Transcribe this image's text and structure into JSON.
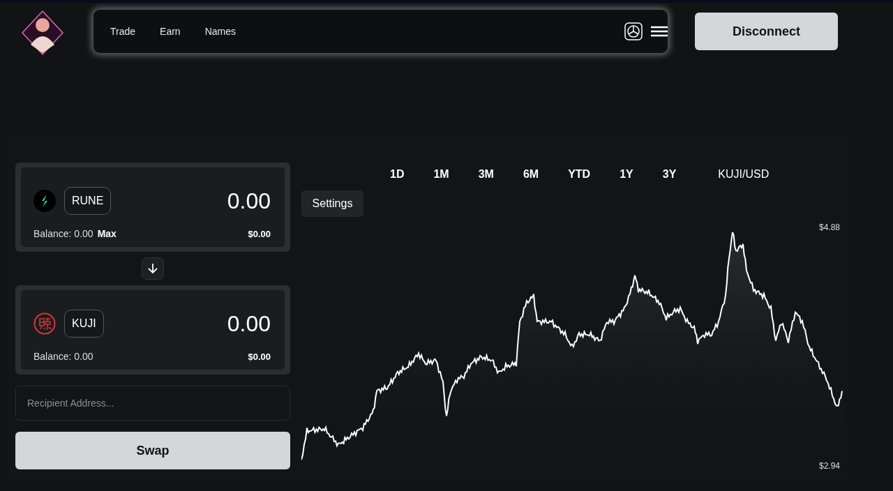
{
  "header": {
    "nav": [
      {
        "label": "Trade"
      },
      {
        "label": "Earn"
      },
      {
        "label": "Names"
      }
    ],
    "disconnect": "Disconnect"
  },
  "swap": {
    "tokens": [
      {
        "kind": "bolt",
        "token": "RUNE",
        "amount": "0.00",
        "balance": "Balance: 0.00",
        "max": "Max",
        "value": "$0.00"
      },
      {
        "kind": "seal",
        "token": "KUJI",
        "amount": "0.00",
        "balance": "Balance: 0.00",
        "value": "$0.00"
      }
    ],
    "recipient": {
      "placeholder": "Recipient Address..."
    },
    "swap_button": "Swap"
  },
  "chart": {
    "ranges": [
      "1D",
      "1M",
      "3M",
      "6M",
      "YTD",
      "1Y",
      "3Y"
    ],
    "pair": "KUJI/USD",
    "settings": "Settings",
    "high_label": "$4.88",
    "low_label": "$2.94"
  }
}
